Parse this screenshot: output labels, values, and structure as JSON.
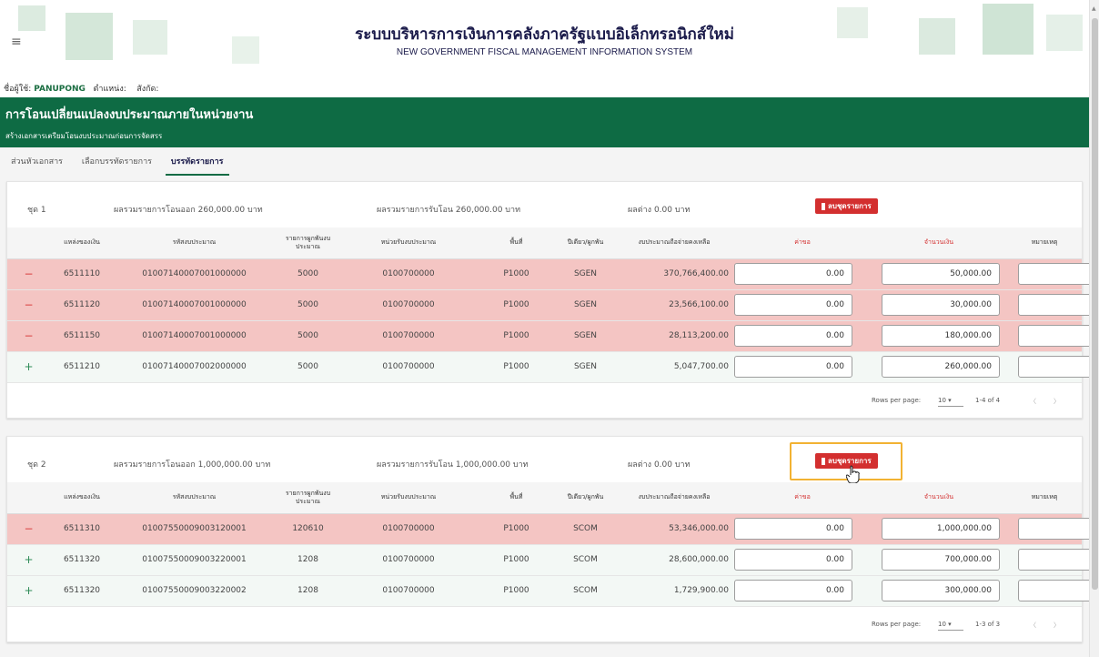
{
  "header": {
    "menu_icon": "hamburger-icon",
    "title_th": "ระบบบริหารการเงินการคลังภาครัฐแบบอิเล็กทรอนิกส์ใหม่",
    "title_en": "NEW GOVERNMENT FISCAL MANAGEMENT INFORMATION SYSTEM"
  },
  "user": {
    "label": "ชื่อผู้ใช้:",
    "name": "PANUPONG",
    "position_label": "ตำแหน่ง:",
    "affiliation_label": "สังกัด:"
  },
  "banner": {
    "title": "การโอนเปลี่ยนแปลงงบประมาณภายในหน่วยงาน",
    "subtitle": "สร้างเอกสารเตรียมโอนงบประมาณก่อนการจัดสรร"
  },
  "tabs": [
    "ส่วนหัวเอกสาร",
    "เลือกบรรทัดรายการ",
    "บรรทัดรายการ"
  ],
  "columns": [
    "แหล่งของเงิน",
    "รหัสงบประมาณ",
    "รายการผูกพันงบประมาณ",
    "หน่วยรับงบประมาณ",
    "พื้นที่",
    "ปีเดียว/ผูกพัน",
    "งบประมาณถือจ่ายคงเหลือ",
    "ค่าขอ",
    "จำนวนเงิน",
    "หมายเหตุ"
  ],
  "delete_label": "ลบชุดรายการ",
  "pager": {
    "rows_per_page_label": "Rows per page:",
    "rows_per_page": "10"
  },
  "sets": [
    {
      "label": "ชุด 1",
      "out_total": "ผลรวมรายการโอนออก 260,000.00 บาท",
      "in_total": "ผลรวมรายการรับโอน 260,000.00 บาท",
      "diff": "ผลต่าง 0.00 บาท",
      "range": "1-4 of 4",
      "rows": [
        {
          "sign": "−",
          "source": "6511110",
          "code": "01007140007001000000",
          "oblig": "5000",
          "unit": "0100700000",
          "area": "P1000",
          "year": "SGEN",
          "balance": "370,766,400.00",
          "request": "0.00",
          "amount": "50,000.00",
          "note": ""
        },
        {
          "sign": "−",
          "source": "6511120",
          "code": "01007140007001000000",
          "oblig": "5000",
          "unit": "0100700000",
          "area": "P1000",
          "year": "SGEN",
          "balance": "23,566,100.00",
          "request": "0.00",
          "amount": "30,000.00",
          "note": ""
        },
        {
          "sign": "−",
          "source": "6511150",
          "code": "01007140007001000000",
          "oblig": "5000",
          "unit": "0100700000",
          "area": "P1000",
          "year": "SGEN",
          "balance": "28,113,200.00",
          "request": "0.00",
          "amount": "180,000.00",
          "note": ""
        },
        {
          "sign": "+",
          "source": "6511210",
          "code": "01007140007002000000",
          "oblig": "5000",
          "unit": "0100700000",
          "area": "P1000",
          "year": "SGEN",
          "balance": "5,047,700.00",
          "request": "0.00",
          "amount": "260,000.00",
          "note": ""
        }
      ]
    },
    {
      "label": "ชุด 2",
      "out_total": "ผลรวมรายการโอนออก 1,000,000.00 บาท",
      "in_total": "ผลรวมรายการรับโอน 1,000,000.00 บาท",
      "diff": "ผลต่าง 0.00 บาท",
      "range": "1-3 of 3",
      "rows": [
        {
          "sign": "−",
          "source": "6511310",
          "code": "01007550009003120001",
          "oblig": "120610",
          "unit": "0100700000",
          "area": "P1000",
          "year": "SCOM",
          "balance": "53,346,000.00",
          "request": "0.00",
          "amount": "1,000,000.00",
          "note": ""
        },
        {
          "sign": "+",
          "source": "6511320",
          "code": "01007550009003220001",
          "oblig": "1208",
          "unit": "0100700000",
          "area": "P1000",
          "year": "SCOM",
          "balance": "28,600,000.00",
          "request": "0.00",
          "amount": "700,000.00",
          "note": ""
        },
        {
          "sign": "+",
          "source": "6511320",
          "code": "01007550009003220002",
          "oblig": "1208",
          "unit": "0100700000",
          "area": "P1000",
          "year": "SCOM",
          "balance": "1,729,900.00",
          "request": "0.00",
          "amount": "300,000.00",
          "note": ""
        }
      ]
    }
  ]
}
